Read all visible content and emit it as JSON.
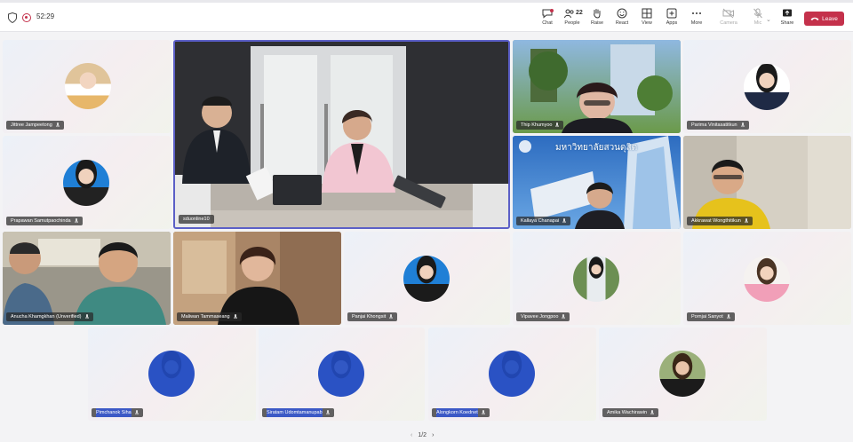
{
  "top_bar": {
    "timer": "52:29",
    "buttons": [
      {
        "label": "Chat",
        "icon": "chat-icon"
      },
      {
        "label": "People",
        "icon": "people-icon",
        "count": "22"
      },
      {
        "label": "Raise",
        "icon": "raise-hand-icon"
      },
      {
        "label": "React",
        "icon": "react-icon"
      },
      {
        "label": "View",
        "icon": "view-icon"
      },
      {
        "label": "Apps",
        "icon": "apps-icon"
      },
      {
        "label": "More",
        "icon": "more-icon"
      },
      {
        "label": "Camera",
        "icon": "camera-off-icon"
      },
      {
        "label": "Mic",
        "icon": "mic-off-icon"
      },
      {
        "label": "Share",
        "icon": "share-icon"
      }
    ],
    "leave_label": "Leave"
  },
  "participants": [
    "Jittree Jampeetong",
    "sduonline10",
    "Thip Khumyoo",
    "Parima Vinitasatitkun",
    "Prapawan Samutpaochinda",
    "Kallaya Chanapai",
    "Akkrawat Wongthitikun",
    "Anucha Khamgkhan (Unverified)",
    "Maliwan Tammaseang",
    "Panjai Khongsit",
    "Vipavee Jongpoo",
    "Pornjai Sanyot",
    "Pimchanok Siha",
    "Siratam Udomtamanupab",
    "Alongkorn Koednet",
    "Amika Wachirawin"
  ],
  "banner_text": "มหาวิทยาลัยสวนดุสิต",
  "pager": {
    "label": "1/2"
  },
  "colors": {
    "leave": "#c4314b",
    "active_speaker": "#5b5fc7",
    "selected_name": "#3c59c6"
  }
}
